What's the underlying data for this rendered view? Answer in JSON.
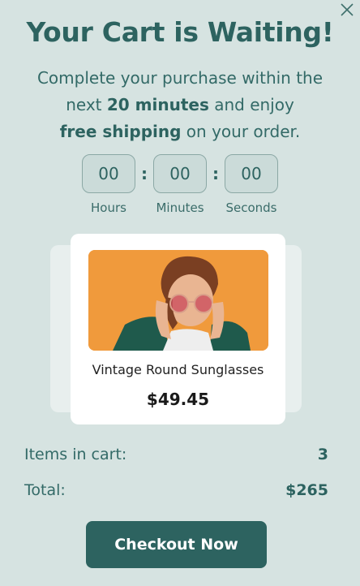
{
  "popup": {
    "title": "Your Cart is Waiting!",
    "subtitle": {
      "part1": "Complete your purchase within the next ",
      "highlight_time": "20 minutes",
      "part2": " and enjoy ",
      "highlight_offer": "free shipping",
      "part3": " on your order."
    },
    "close_icon": "close-icon"
  },
  "timer": {
    "hours": "00",
    "minutes": "00",
    "seconds": "00",
    "separator": ":",
    "hours_label": "Hours",
    "minutes_label": "Minutes",
    "seconds_label": "Seconds"
  },
  "product": {
    "name": "Vintage Round Sunglasses",
    "price": "$49.45"
  },
  "summary": {
    "items_label": "Items in cart:",
    "items_value": "3",
    "total_label": "Total:",
    "total_value": "$265"
  },
  "checkout": {
    "label": "Checkout Now"
  },
  "colors": {
    "background": "#d6e3e1",
    "accent": "#2d6360",
    "product_image_bg": "#f09a3c"
  }
}
